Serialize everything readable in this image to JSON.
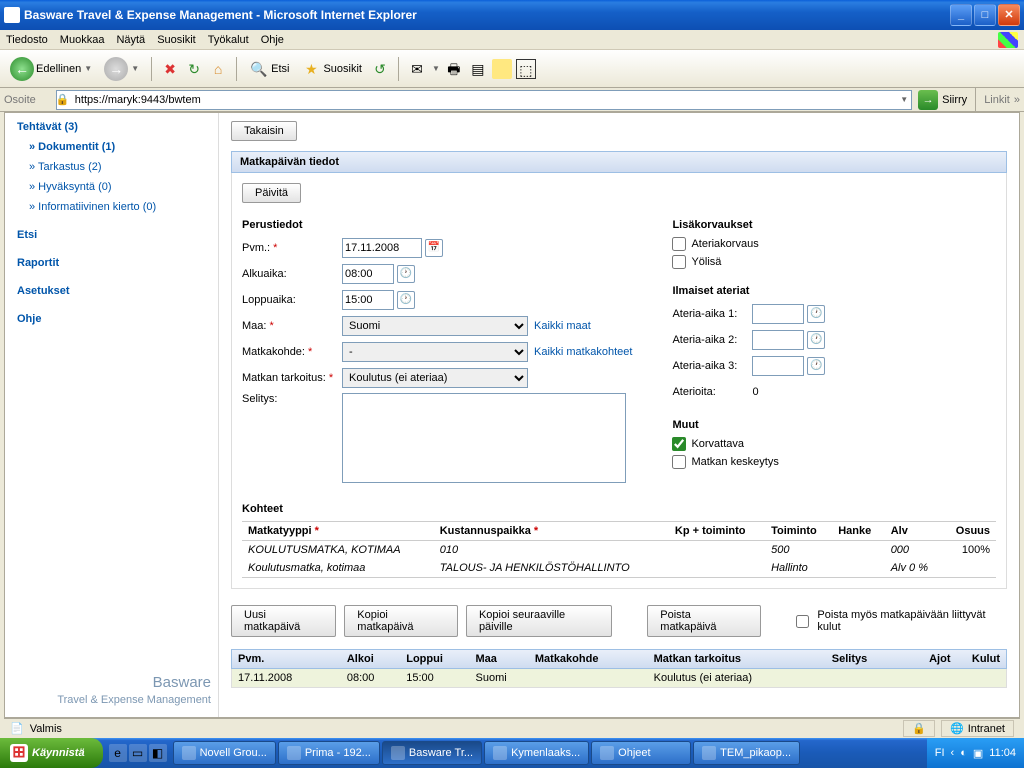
{
  "window": {
    "title": "Basware Travel & Expense Management - Microsoft Internet Explorer"
  },
  "menu": {
    "items": [
      "Tiedosto",
      "Muokkaa",
      "Näytä",
      "Suosikit",
      "Työkalut",
      "Ohje"
    ]
  },
  "toolbar": {
    "back": "Edellinen",
    "search": "Etsi",
    "fav": "Suosikit"
  },
  "address": {
    "label": "Osoite",
    "url": "https://maryk:9443/bwtem",
    "go": "Siirry",
    "links": "Linkit"
  },
  "sidebar": {
    "items": [
      {
        "label": "Tehtävät (3)",
        "bold": true
      },
      {
        "label": "» Dokumentit (1)",
        "sub": true,
        "bold": true
      },
      {
        "label": "» Tarkastus (2)",
        "sub": true
      },
      {
        "label": "» Hyväksyntä (0)",
        "sub": true
      },
      {
        "label": "» Informatiivinen kierto (0)",
        "sub": true
      },
      {
        "label": "Etsi",
        "bold": true
      },
      {
        "label": "Raportit",
        "bold": true
      },
      {
        "label": "Asetukset",
        "bold": true
      },
      {
        "label": "Ohje",
        "bold": true
      }
    ],
    "logo1": "Basware",
    "logo2": "Travel & Expense Management"
  },
  "main": {
    "back_btn": "Takaisin",
    "panel_title": "Matkapäivän tiedot",
    "update_btn": "Päivitä",
    "basic": {
      "title": "Perustiedot",
      "pvm_lbl": "Pvm.:",
      "pvm_val": "17.11.2008",
      "alku_lbl": "Alkuaika:",
      "alku_val": "08:00",
      "loppu_lbl": "Loppuaika:",
      "loppu_val": "15:00",
      "maa_lbl": "Maa:",
      "maa_val": "Suomi",
      "maa_link": "Kaikki maat",
      "kohde_lbl": "Matkakohde:",
      "kohde_val": "-",
      "kohde_link": "Kaikki matkakohteet",
      "tark_lbl": "Matkan tarkoitus:",
      "tark_val": "Koulutus (ei ateriaa)",
      "selitys_lbl": "Selitys:"
    },
    "lisak": {
      "title": "Lisäkorvaukset",
      "ateria": "Ateriakorvaus",
      "yolisa": "Yölisä"
    },
    "ilm": {
      "title": "Ilmaiset ateriat",
      "a1": "Ateria-aika 1:",
      "a2": "Ateria-aika 2:",
      "a3": "Ateria-aika 3:",
      "count_lbl": "Aterioita:",
      "count_val": "0"
    },
    "muut": {
      "title": "Muut",
      "korv": "Korvattava",
      "kesk": "Matkan keskeytys"
    },
    "kohteet": {
      "title": "Kohteet",
      "h1": "Matkatyyppi",
      "h2": "Kustannuspaikka",
      "h3": "Kp + toiminto",
      "h4": "Toiminto",
      "h5": "Hanke",
      "h6": "Alv",
      "h7": "Osuus",
      "r1c1": "KOULUTUSMATKA, KOTIMAA",
      "r1c2": "010",
      "r1c4": "500",
      "r1c6": "000",
      "r1c7": "100%",
      "r2c1": "Koulutusmatka, kotimaa",
      "r2c2": "TALOUS- JA HENKILÖSTÖHALLINTO",
      "r2c4": "Hallinto",
      "r2c6": "Alv 0 %"
    },
    "actions": {
      "uusi": "Uusi matkapäivä",
      "kopioi": "Kopioi matkapäivä",
      "kopioi_seur": "Kopioi seuraaville päiville",
      "poista": "Poista matkapäivä",
      "poista_chk": "Poista myös matkapäivään liittyvät kulut"
    },
    "days": {
      "h_pvm": "Pvm.",
      "h_alk": "Alkoi",
      "h_lop": "Loppui",
      "h_maa": "Maa",
      "h_kohde": "Matkakohde",
      "h_tark": "Matkan tarkoitus",
      "h_sel": "Selitys",
      "h_ajot": "Ajot",
      "h_kulut": "Kulut",
      "r_pvm": "17.11.2008",
      "r_alk": "08:00",
      "r_lop": "15:00",
      "r_maa": "Suomi",
      "r_tark": "Koulutus (ei ateriaa)"
    }
  },
  "status": {
    "ready": "Valmis",
    "zone": "Intranet"
  },
  "taskbar": {
    "start": "Käynnistä",
    "tasks": [
      "Novell Grou...",
      "Prima - 192...",
      "Basware Tr...",
      "Kymenlaaks...",
      "Ohjeet",
      "TEM_pikaop..."
    ],
    "lang": "FI",
    "time": "11:04"
  }
}
